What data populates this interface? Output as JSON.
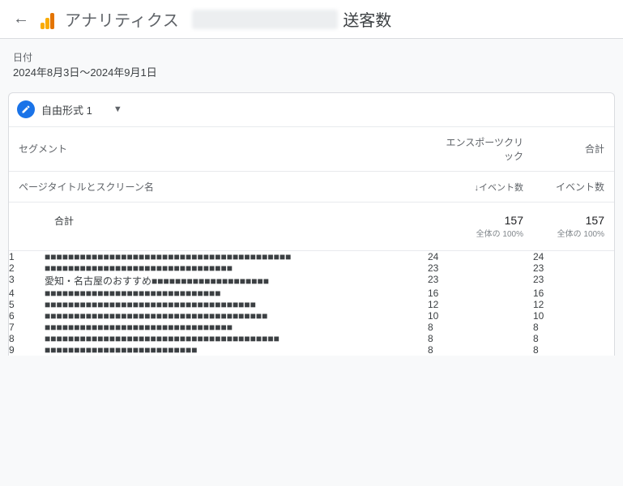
{
  "app": {
    "name": "アナリティクス",
    "page_title": "送客数"
  },
  "date": {
    "label": "日付",
    "range": "2024年8月3日～2024年9月1日"
  },
  "tab": {
    "name": "自由形式 1"
  },
  "table": {
    "dim_header1": "セグメント",
    "dim_header2": "ページタイトルとスクリーン名",
    "seg_header": "エンスポーツクリック",
    "total_header": "合計",
    "metric_header": "イベント数",
    "sort_indicator": "↓イベント数",
    "totals": {
      "label": "合計",
      "v1": "157",
      "v1_sub": "全体の 100%",
      "v2": "157",
      "v2_sub": "全体の 100%",
      "max": 157
    },
    "rows": [
      {
        "idx": "1",
        "title": "■■■■■■■■■■■■■■■■■■■■■■■■■■■■■■■■■■■■■■■■■■",
        "v1": 24,
        "v2": 24
      },
      {
        "idx": "2",
        "title": "■■■■■■■■■■■■■■■■■■■■■■■■■■■■■■■■",
        "v1": 23,
        "v2": 23
      },
      {
        "idx": "3",
        "title_clear": "愛知・名古屋のおすすめ",
        "title": "■■■■■■■■■■■■■■■■■■■■",
        "v1": 23,
        "v2": 23
      },
      {
        "idx": "4",
        "title": "■■■■■■■■■■■■■■■■■■■■■■■■■■■■■■",
        "v1": 16,
        "v2": 16
      },
      {
        "idx": "5",
        "title": "■■■■■■■■■■■■■■■■■■■■■■■■■■■■■■■■■■■■",
        "v1": 12,
        "v2": 12
      },
      {
        "idx": "6",
        "title": "■■■■■■■■■■■■■■■■■■■■■■■■■■■■■■■■■■■■■■",
        "v1": 10,
        "v2": 10
      },
      {
        "idx": "7",
        "title": "■■■■■■■■■■■■■■■■■■■■■■■■■■■■■■■■",
        "v1": 8,
        "v2": 8
      },
      {
        "idx": "8",
        "title": "■■■■■■■■■■■■■■■■■■■■■■■■■■■■■■■■■■■■■■■■",
        "v1": 8,
        "v2": 8
      },
      {
        "idx": "9",
        "title": "■■■■■■■■■■■■■■■■■■■■■■■■■■",
        "v1": 8,
        "v2": 8
      }
    ]
  },
  "chart_data": {
    "type": "bar",
    "categories": [
      "1",
      "2",
      "3",
      "4",
      "5",
      "6",
      "7",
      "8",
      "9"
    ],
    "values": [
      24,
      23,
      23,
      16,
      12,
      10,
      8,
      8,
      8
    ],
    "title": "エンスポーツクリック イベント数",
    "xlabel": "",
    "ylabel": "イベント数",
    "ylim": [
      0,
      24
    ]
  }
}
